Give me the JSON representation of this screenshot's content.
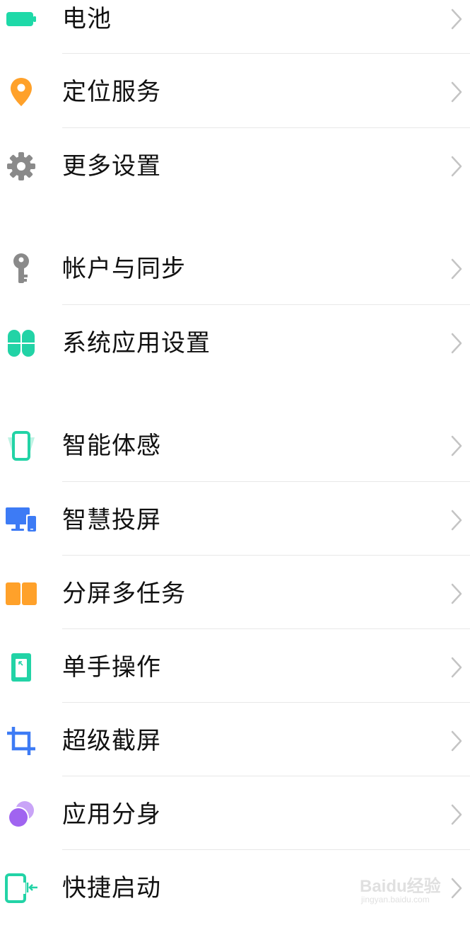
{
  "settings": {
    "items": [
      {
        "label": "电池",
        "icon": "battery-icon"
      },
      {
        "label": "定位服务",
        "icon": "location-pin-icon"
      },
      {
        "label": "更多设置",
        "icon": "gear-icon"
      },
      {
        "label": "帐户与同步",
        "icon": "key-icon"
      },
      {
        "label": "系统应用设置",
        "icon": "four-petal-apps-icon"
      },
      {
        "label": "智能体感",
        "icon": "phone-motion-icon"
      },
      {
        "label": "智慧投屏",
        "icon": "screen-cast-icon"
      },
      {
        "label": "分屏多任务",
        "icon": "split-screen-icon"
      },
      {
        "label": "单手操作",
        "icon": "one-hand-phone-icon"
      },
      {
        "label": "超级截屏",
        "icon": "crop-icon"
      },
      {
        "label": "应用分身",
        "icon": "app-clone-icon"
      },
      {
        "label": "快捷启动",
        "icon": "quick-launch-icon"
      }
    ]
  },
  "colors": {
    "battery": "#1ed9a8",
    "location": "#ffa12a",
    "gear": "#8a8a8a",
    "key": "#8a8a8a",
    "apps": "#22d3a6",
    "motion": "#22d3a6",
    "cast": "#3d7bf5",
    "split": "#ffa12a",
    "one_hand": "#22d3a6",
    "crop": "#3d7bf5",
    "clone": "#a064f0",
    "quick": "#22d3a6",
    "chevron": "#c4c4c4",
    "divider": "#e8e8e8"
  },
  "watermark": {
    "main": "Baidu经验",
    "sub": "jingyan.baidu.com"
  }
}
